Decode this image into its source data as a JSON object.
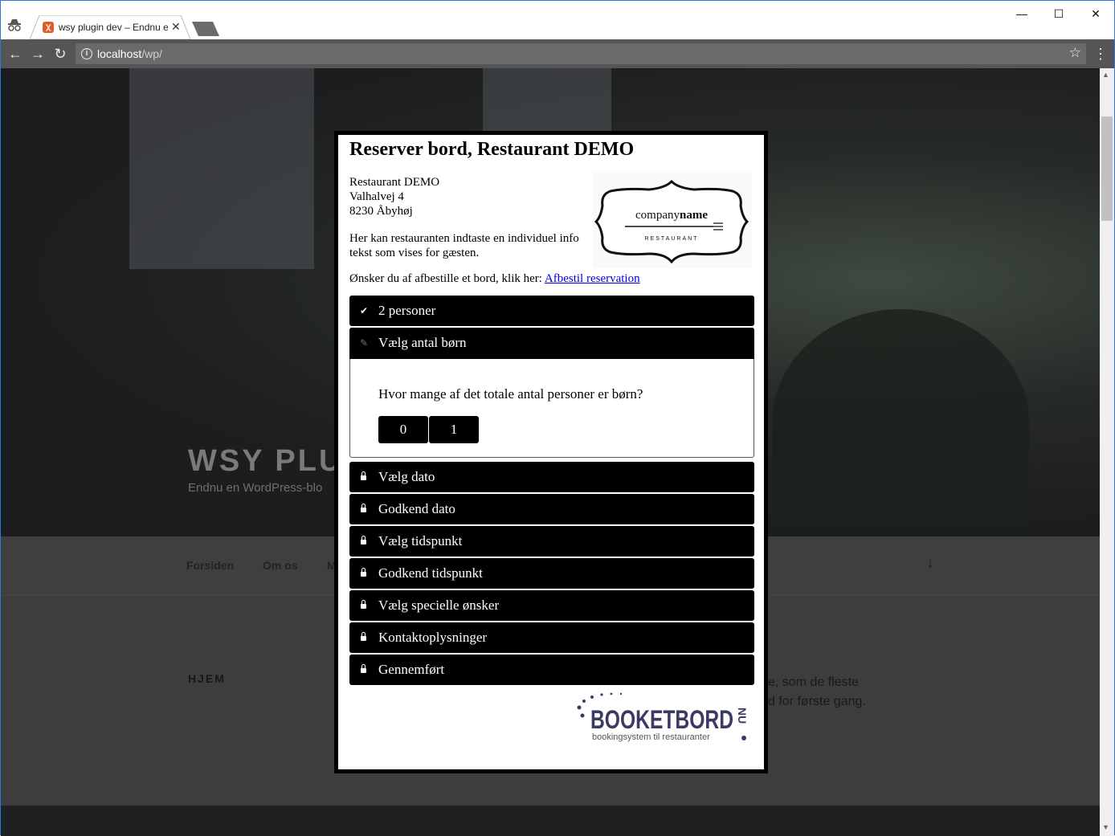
{
  "browser": {
    "tab_title": "wsy plugin dev – Endnu e",
    "url_host": "localhost",
    "url_path": "/wp/",
    "window_controls": {
      "minimize": "—",
      "maximize": "☐",
      "close": "✕"
    }
  },
  "site": {
    "title": "WSY PLU",
    "description": "Endnu en WordPress-blo",
    "nav": [
      "Forsiden",
      "Om os",
      "M"
    ],
    "section_heading": "HJEM",
    "body_line_1": "e, som de fleste",
    "body_line_2": "d for første gang."
  },
  "modal": {
    "title": "Reserver bord, Restaurant DEMO",
    "address": [
      "Restaurant DEMO",
      "Valhalvej 4",
      "8230 Åbyhøj"
    ],
    "info_text": "Her kan restauranten indtaste en individuel info tekst som vises for gæsten.",
    "cancel_prompt": "Ønsker du af afbestille et bord, klik her:",
    "cancel_link": "Afbestil reservation",
    "logo": {
      "word1": "company",
      "word2": "name",
      "sub": "RESTAURANT"
    },
    "steps": [
      {
        "label": "2 personer",
        "state": "done",
        "icon": "check-icon"
      },
      {
        "label": "Vælg antal børn",
        "state": "active",
        "icon": "pencil-icon"
      },
      {
        "label": "Vælg dato",
        "state": "locked",
        "icon": "lock-icon"
      },
      {
        "label": "Godkend dato",
        "state": "locked",
        "icon": "lock-icon"
      },
      {
        "label": "Vælg tidspunkt",
        "state": "locked",
        "icon": "lock-icon"
      },
      {
        "label": "Godkend tidspunkt",
        "state": "locked",
        "icon": "lock-icon"
      },
      {
        "label": "Vælg specielle ønsker",
        "state": "locked",
        "icon": "lock-icon"
      },
      {
        "label": "Kontaktoplysninger",
        "state": "locked",
        "icon": "lock-icon"
      },
      {
        "label": "Gennemført",
        "state": "locked",
        "icon": "lock-icon"
      }
    ],
    "children_question": "Hvor mange af det totale antal personer er børn?",
    "children_options": [
      "0",
      "1"
    ],
    "brand": {
      "main": "BOOKETBORD",
      "suffix": "NU",
      "tagline": "bookingsystem til restauranter"
    }
  }
}
